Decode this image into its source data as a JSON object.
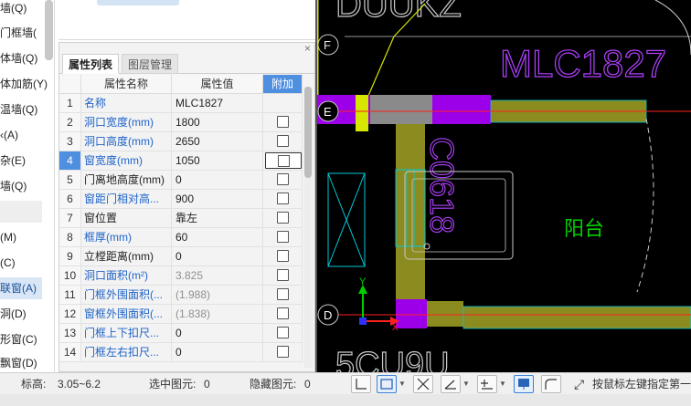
{
  "left_tree": {
    "items": [
      {
        "label": "墙(Q)"
      },
      {
        "label": "门框墙("
      },
      {
        "label": "体墙(Q)"
      },
      {
        "label": "体加筋(Y)"
      },
      {
        "label": "温墙(Q)"
      },
      {
        "label": "‹(A)"
      },
      {
        "label": "杂(E)"
      },
      {
        "label": "墙(Q)"
      },
      {
        "label": "(M)"
      },
      {
        "label": "(C)"
      },
      {
        "label": "联窗(A)"
      },
      {
        "label": "洞(D)"
      },
      {
        "label": "形窗(C)"
      },
      {
        "label": "飘窗(D)"
      }
    ]
  },
  "property_panel": {
    "close_label": "×",
    "tabs": [
      "属性列表",
      "图层管理"
    ],
    "headers": {
      "name": "属性名称",
      "value": "属性值",
      "extra": "附加"
    },
    "rows": [
      {
        "num": "1",
        "name": "名称",
        "value": "MLC1827",
        "name_style": "blue",
        "value_style": "normal",
        "has_check": false
      },
      {
        "num": "2",
        "name": "洞口宽度(mm)",
        "value": "1800",
        "name_style": "blue",
        "value_style": "normal",
        "has_check": true
      },
      {
        "num": "3",
        "name": "洞口高度(mm)",
        "value": "2650",
        "name_style": "blue",
        "value_style": "normal",
        "has_check": true
      },
      {
        "num": "4",
        "name": "窗宽度(mm)",
        "value": "1050",
        "name_style": "blue",
        "value_style": "normal",
        "has_check": true
      },
      {
        "num": "5",
        "name": "门离地高度(mm)",
        "value": "0",
        "name_style": "normal",
        "value_style": "normal",
        "has_check": true
      },
      {
        "num": "6",
        "name": "窗距门相对高...",
        "value": "900",
        "name_style": "blue",
        "value_style": "normal",
        "has_check": true
      },
      {
        "num": "7",
        "name": "窗位置",
        "value": "靠左",
        "name_style": "normal",
        "value_style": "normal",
        "has_check": true
      },
      {
        "num": "8",
        "name": "框厚(mm)",
        "value": "60",
        "name_style": "blue",
        "value_style": "normal",
        "has_check": true
      },
      {
        "num": "9",
        "name": "立樘距离(mm)",
        "value": "0",
        "name_style": "normal",
        "value_style": "normal",
        "has_check": true
      },
      {
        "num": "10",
        "name": "洞口面积(m²)",
        "value": "3.825",
        "name_style": "blue",
        "value_style": "gray",
        "has_check": true
      },
      {
        "num": "11",
        "name": "门框外围面积(...",
        "value": "(1.988)",
        "name_style": "blue",
        "value_style": "gray",
        "has_check": true
      },
      {
        "num": "12",
        "name": "窗框外围面积(...",
        "value": "(1.838)",
        "name_style": "blue",
        "value_style": "gray",
        "has_check": true
      },
      {
        "num": "13",
        "name": "门框上下扣尺...",
        "value": "0",
        "name_style": "blue",
        "value_style": "normal",
        "has_check": true
      },
      {
        "num": "14",
        "name": "门框左右扣尺...",
        "value": "0",
        "name_style": "blue",
        "value_style": "normal",
        "has_check": true
      }
    ],
    "selected_row": "4"
  },
  "canvas": {
    "grid_labels": [
      "F",
      "E",
      "D"
    ],
    "texts": {
      "mlc": "MLC1827",
      "c0618": "C0618",
      "balcony": "阳台",
      "top_fragment": "DUUKZ",
      "bottom_fragment": "5CU9U"
    },
    "axes": {
      "y": "Y",
      "x": "X"
    },
    "colors": {
      "background": "#000000",
      "wall_olive": "#8b8b1f",
      "window_purple": "#9b00e8",
      "gray_block": "#8a8a8a",
      "axis_red": "#ff2020",
      "yellow": "#d6e600",
      "cyan": "#00c8d8",
      "green_text": "#00d000",
      "magenta_text": "#b040ff"
    }
  },
  "status_bar": {
    "elevation_label": "标高:",
    "elevation_value": "3.05~6.2",
    "selected_label": "选中图元:",
    "selected_value": "0",
    "hidden_label": "隐藏图元:",
    "hidden_value": "0",
    "hint": "按鼠标左键指定第一"
  }
}
